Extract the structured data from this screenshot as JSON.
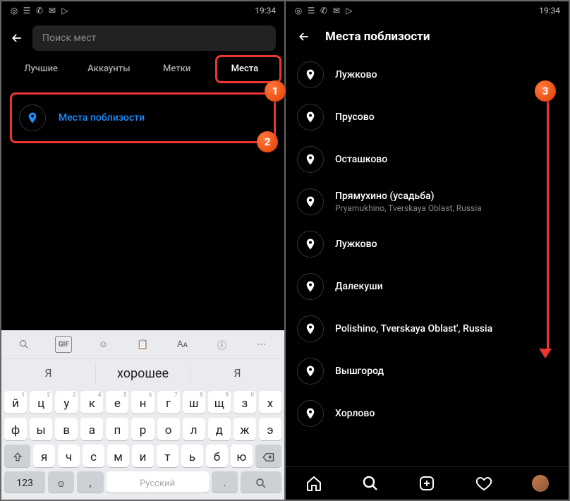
{
  "status_time": "19:34",
  "left": {
    "search_placeholder": "Поиск мест",
    "tabs": [
      "Лучшие",
      "Аккаунты",
      "Метки",
      "Места"
    ],
    "active_tab": 3,
    "nearby_label": "Места поблизости",
    "annotations": {
      "tab": "1",
      "nearby": "2"
    }
  },
  "keyboard": {
    "suggestions": [
      "Я",
      "хорошее",
      "Я"
    ],
    "row1": [
      {
        "k": "й",
        "n": "1"
      },
      {
        "k": "ц",
        "n": "2"
      },
      {
        "k": "у",
        "n": "3"
      },
      {
        "k": "к",
        "n": "4"
      },
      {
        "k": "е",
        "n": "5"
      },
      {
        "k": "н",
        "n": "6"
      },
      {
        "k": "г",
        "n": "7"
      },
      {
        "k": "ш",
        "n": "8"
      },
      {
        "k": "щ",
        "n": "9"
      },
      {
        "k": "з",
        "n": "0"
      },
      {
        "k": "х",
        "n": ""
      }
    ],
    "row2": [
      {
        "k": "ф"
      },
      {
        "k": "ы"
      },
      {
        "k": "в"
      },
      {
        "k": "а"
      },
      {
        "k": "п"
      },
      {
        "k": "р"
      },
      {
        "k": "о"
      },
      {
        "k": "л"
      },
      {
        "k": "д"
      },
      {
        "k": "ж"
      },
      {
        "k": "э"
      }
    ],
    "row3": [
      {
        "k": "я"
      },
      {
        "k": "ч"
      },
      {
        "k": "с"
      },
      {
        "k": "м"
      },
      {
        "k": "и"
      },
      {
        "k": "т"
      },
      {
        "k": "ь"
      },
      {
        "k": "б"
      },
      {
        "k": "ю"
      }
    ],
    "num_label": "123",
    "space_label": "Русский"
  },
  "right": {
    "title": "Места поблизости",
    "annotation": "3",
    "places": [
      {
        "name": "Лужково",
        "sub": ""
      },
      {
        "name": "Прусово",
        "sub": ""
      },
      {
        "name": "Осташково",
        "sub": ""
      },
      {
        "name": "Прямухино (усадьба)",
        "sub": "Pryamukhino, Tverskaya Oblast, Russia"
      },
      {
        "name": "Лужково",
        "sub": ""
      },
      {
        "name": "Далекуши",
        "sub": ""
      },
      {
        "name": "Polishino, Tverskaya Oblast', Russia",
        "sub": ""
      },
      {
        "name": "Вышгород",
        "sub": ""
      },
      {
        "name": "Хорлово",
        "sub": ""
      }
    ]
  }
}
